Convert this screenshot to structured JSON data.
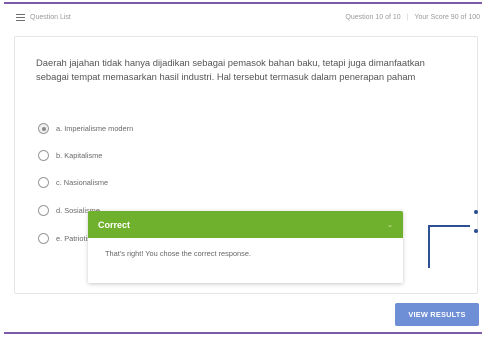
{
  "header": {
    "question_list": "Question List",
    "question_counter": "Question 10 of 10",
    "separator": "|",
    "score": "Your Score 90 of 100"
  },
  "question": {
    "text": "Daerah jajahan tidak hanya dijadikan sebagai pemasok bahan baku, tetapi juga dimanfaatkan sebagai tempat memasarkan hasil industri. Hal tersebut termasuk dalam penerapan paham",
    "options": [
      {
        "label": "a. Imperialisme modern",
        "selected": true
      },
      {
        "label": "b. Kapitalisme",
        "selected": false
      },
      {
        "label": "c. Nasionalisme",
        "selected": false
      },
      {
        "label": "d. Sosialisme",
        "selected": false
      },
      {
        "label": "e. Patriotisme",
        "selected": false
      }
    ]
  },
  "feedback": {
    "title": "Correct",
    "message": "That's right! You chose the correct response.",
    "accent_color": "#6fb12c"
  },
  "actions": {
    "view_results": "VIEW RESULTS"
  },
  "colors": {
    "brand_rule": "#7e5aa8",
    "button": "#6e8fd6",
    "decoration": "#2d4f93"
  }
}
